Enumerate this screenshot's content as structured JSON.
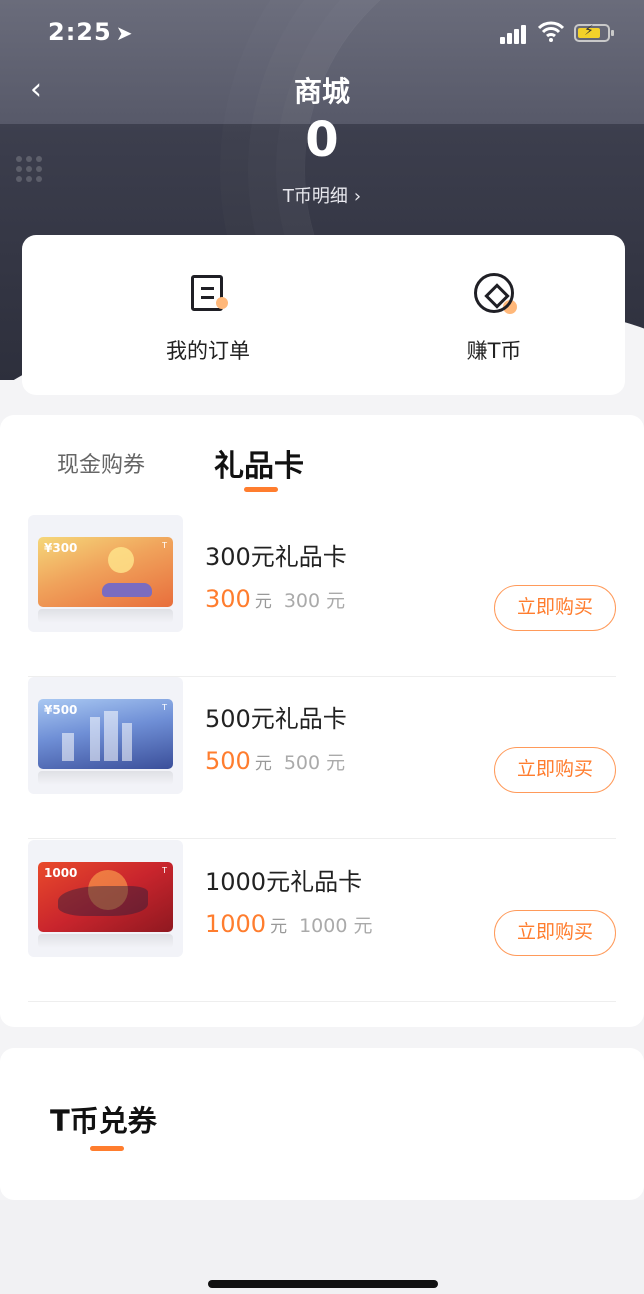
{
  "status_bar": {
    "time": "2:25",
    "location_glyph": "➤"
  },
  "nav": {
    "back_glyph": "‹",
    "title": "商城"
  },
  "balance": {
    "value": "0",
    "detail_label": "T币明细",
    "detail_chevron": "›"
  },
  "actions": {
    "orders_label": "我的订单",
    "earn_label": "赚T币"
  },
  "tabs": [
    {
      "label": "现金购券",
      "active": false
    },
    {
      "label": "礼品卡",
      "active": true
    }
  ],
  "products": [
    {
      "name": "300元礼品卡",
      "price": "300",
      "unit": "元",
      "original": "300 元",
      "card_label": "¥300",
      "buy_label": "立即购买"
    },
    {
      "name": "500元礼品卡",
      "price": "500",
      "unit": "元",
      "original": "500 元",
      "card_label": "¥500",
      "buy_label": "立即购买"
    },
    {
      "name": "1000元礼品卡",
      "price": "1000",
      "unit": "元",
      "original": "1000 元",
      "card_label": "1000",
      "buy_label": "立即购买"
    }
  ],
  "coupon_section": {
    "title": "T币兑券"
  },
  "colors": {
    "accent": "#ff7d2e",
    "header": "#2d2f3c"
  }
}
